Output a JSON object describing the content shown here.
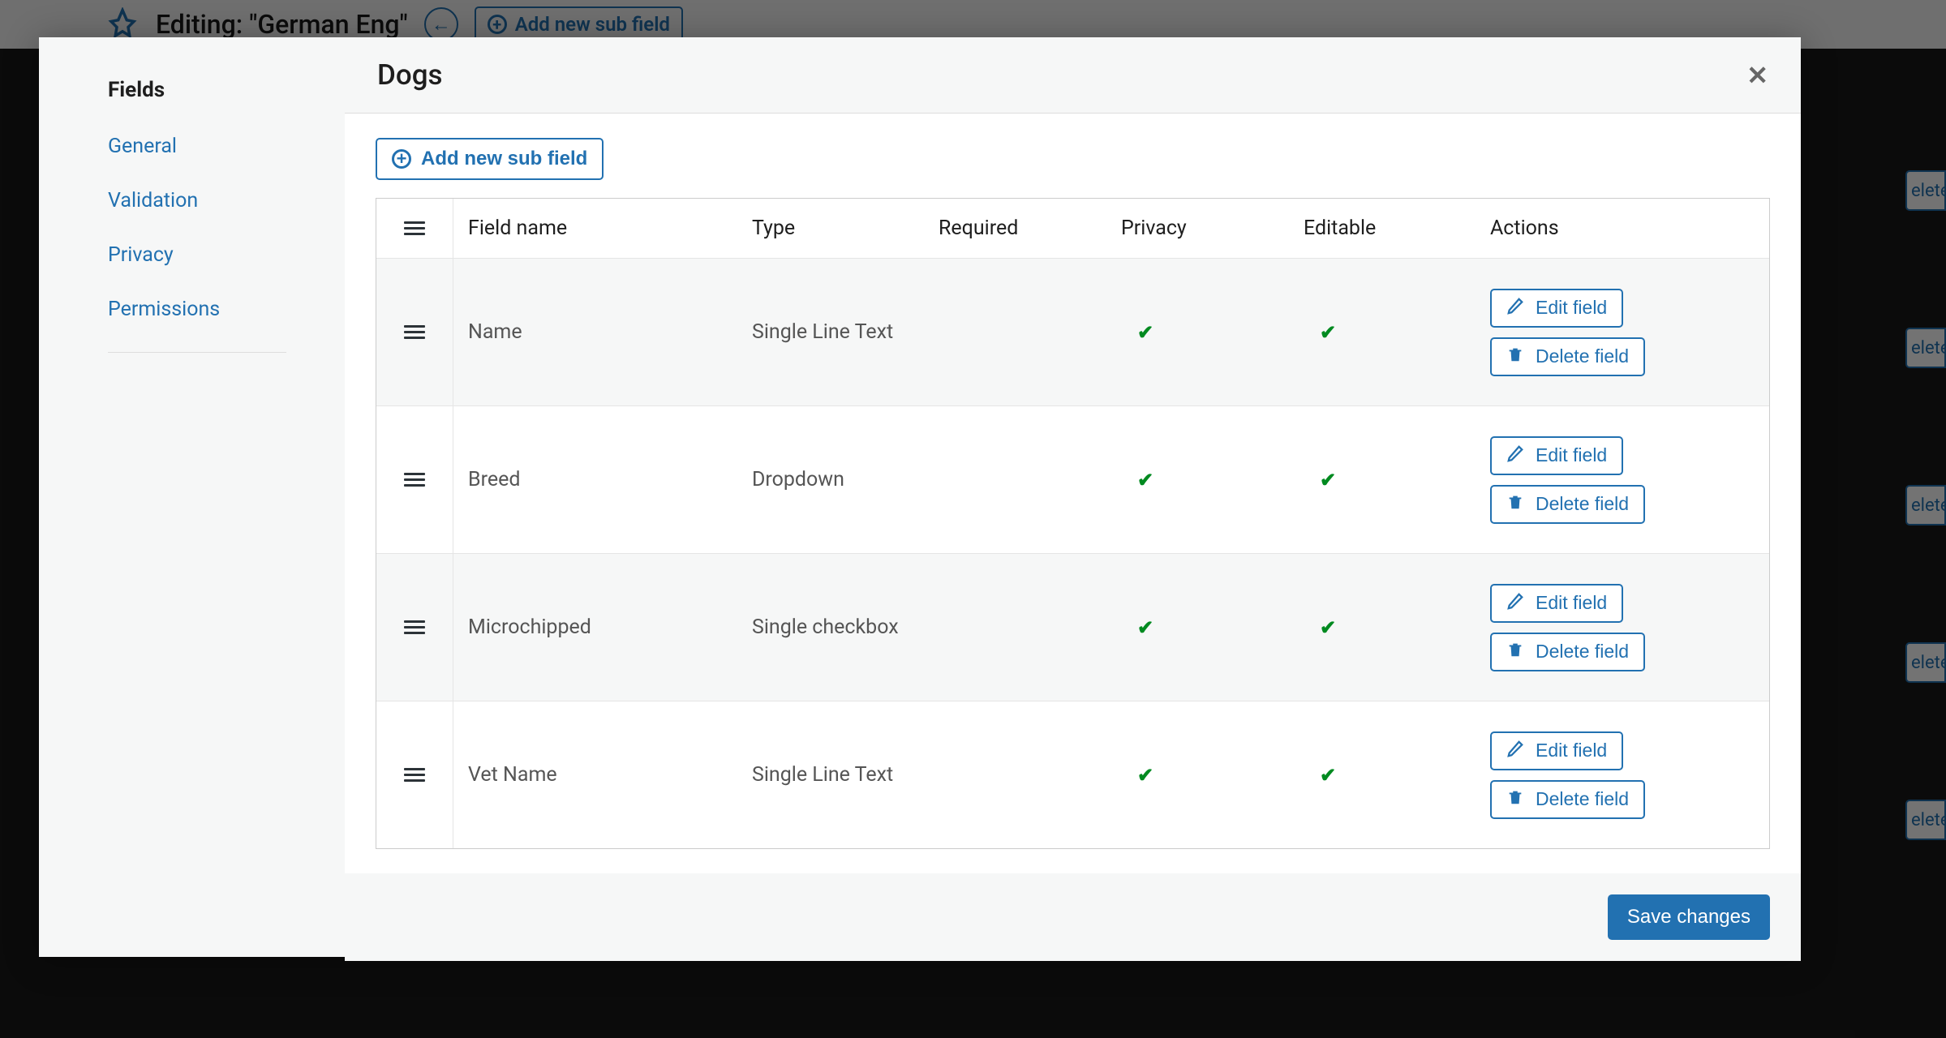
{
  "background": {
    "editing_title": "Editing: \"German Eng\"",
    "add_sub_field": "Add new sub field",
    "right_button_text": "elete"
  },
  "modal": {
    "title": "Dogs",
    "sidebar": {
      "heading": "Fields",
      "links": [
        {
          "label": "General"
        },
        {
          "label": "Validation"
        },
        {
          "label": "Privacy"
        },
        {
          "label": "Permissions"
        }
      ]
    },
    "add_sub_field_label": "Add new sub field",
    "table": {
      "headers": {
        "field_name": "Field name",
        "type": "Type",
        "required": "Required",
        "privacy": "Privacy",
        "editable": "Editable",
        "actions": "Actions"
      },
      "rows": [
        {
          "name": "Name",
          "type": "Single Line Text",
          "required": false,
          "privacy": true,
          "editable": true
        },
        {
          "name": "Breed",
          "type": "Dropdown",
          "required": false,
          "privacy": true,
          "editable": true
        },
        {
          "name": "Microchipped",
          "type": "Single checkbox",
          "required": false,
          "privacy": true,
          "editable": true
        },
        {
          "name": "Vet Name",
          "type": "Single Line Text",
          "required": false,
          "privacy": true,
          "editable": true
        }
      ],
      "edit_label": "Edit field",
      "delete_label": "Delete field"
    },
    "save_label": "Save changes"
  }
}
